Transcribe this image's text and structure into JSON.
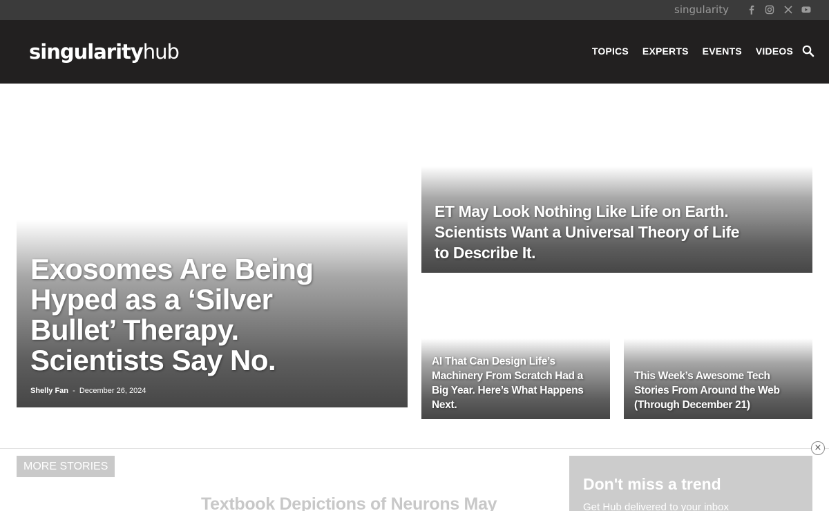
{
  "topbar": {
    "site_link": "singularity",
    "social_icons": [
      "facebook-icon",
      "instagram-icon",
      "x-icon",
      "youtube-icon"
    ]
  },
  "header": {
    "logo_bold": "singularity",
    "logo_light": "hub",
    "nav": [
      "TOPICS",
      "EXPERTS",
      "EVENTS",
      "VIDEOS"
    ],
    "search_icon": "search-icon"
  },
  "featured": {
    "main": {
      "title": "Exosomes Are Being Hyped as a ‘Silver Bullet’ Therapy. Scientists Say No.",
      "author": "Shelly Fan",
      "separator": "-",
      "date": "December 26, 2024"
    },
    "top_right": {
      "title": "ET May Look Nothing Like Life on Earth. Scientists Want a Universal Theory of Life to Describe It."
    },
    "bottom_left": {
      "title": "AI That Can Design Life’s Machinery From Scratch Had a Big Year. Here’s What Happens Next."
    },
    "bottom_right": {
      "title": "This Week’s Awesome Tech Stories From Around the Web (Through December 21)"
    }
  },
  "more_stories": {
    "label": "MORE STORIES",
    "next_title": "Textbook Depictions of Neurons May"
  },
  "newsletter": {
    "title": "Don't miss a trend",
    "subtitle": "Get Hub delivered to your inbox",
    "close": "×"
  },
  "colors": {
    "topbar_bg": "#3b3b3b",
    "header_bg": "#222020",
    "card_overlay": "#464646",
    "more_label_bg": "#c9c9c9",
    "newsletter_bg": "#cccccc"
  }
}
